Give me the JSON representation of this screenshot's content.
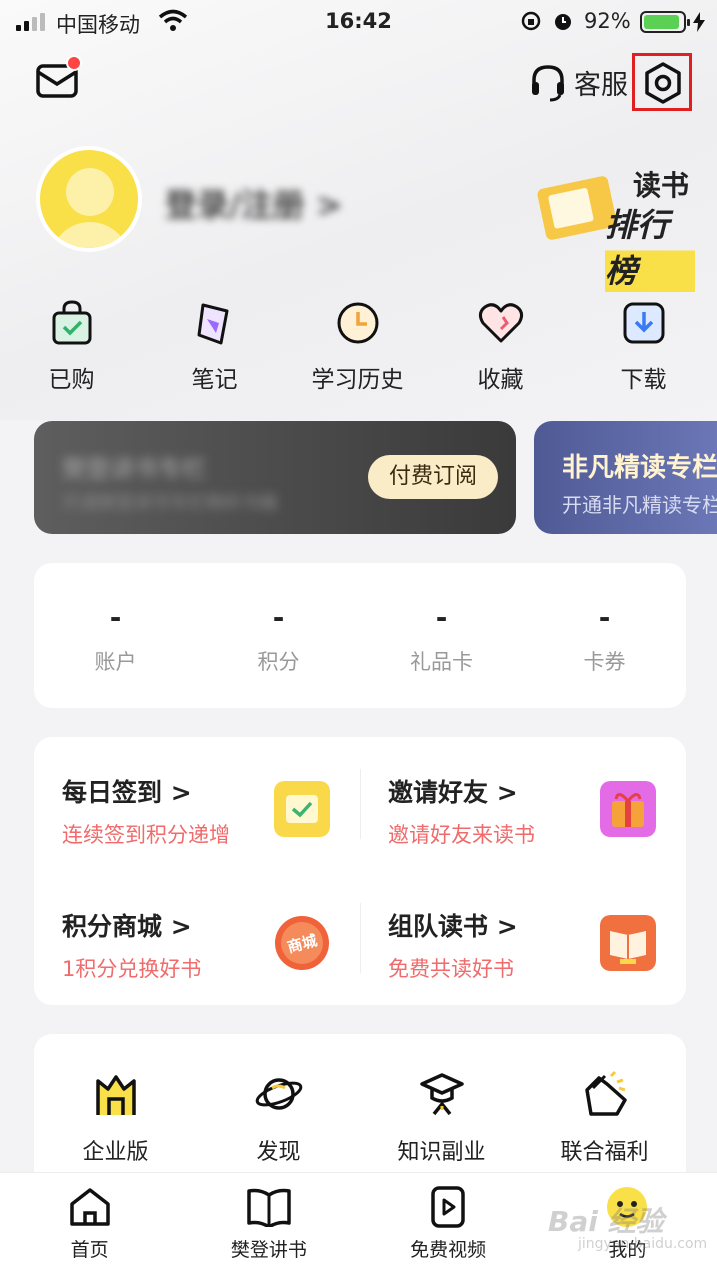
{
  "status_bar": {
    "carrier": "中国移动",
    "time": "16:42",
    "battery": "92%",
    "battery_level": 0.92
  },
  "header": {
    "service_label": "客服"
  },
  "profile": {
    "login_label": "登录/注册 >",
    "rank_line1": "读书",
    "rank_line2": "排行榜"
  },
  "quick_menu": [
    {
      "label": "已购",
      "icon": "shopping-bag-icon"
    },
    {
      "label": "笔记",
      "icon": "note-icon"
    },
    {
      "label": "学习历史",
      "icon": "clock-icon"
    },
    {
      "label": "收藏",
      "icon": "heart-icon"
    },
    {
      "label": "下载",
      "icon": "download-icon"
    }
  ],
  "vip_cards": {
    "first": {
      "title": "樊登讲书专栏",
      "subtitle": "开通樊登讲书专栏畅听书籍",
      "button": "付费订阅"
    },
    "second": {
      "title": "非凡精读专栏",
      "subtitle": "开通非凡精读专栏"
    }
  },
  "assets": [
    {
      "value": "-",
      "label": "账户"
    },
    {
      "value": "-",
      "label": "积分"
    },
    {
      "value": "-",
      "label": "礼品卡"
    },
    {
      "value": "-",
      "label": "卡券"
    }
  ],
  "tasks": [
    {
      "title": "每日签到 >",
      "subtitle": "连续签到积分递增",
      "icon": "calendar-check-icon",
      "color": "#f9d84a"
    },
    {
      "title": "邀请好友 >",
      "subtitle": "邀请好友来读书",
      "icon": "gift-icon",
      "color": "#e46be6"
    },
    {
      "title": "积分商城 >",
      "subtitle": "1积分兑换好书",
      "icon": "mall-badge-icon",
      "color": "#f0623a",
      "badge_text": "商城"
    },
    {
      "title": "组队读书 >",
      "subtitle": "免费共读好书",
      "icon": "open-book-icon",
      "color": "#f07040"
    }
  ],
  "tools": [
    {
      "label": "企业版",
      "icon": "enterprise-icon"
    },
    {
      "label": "发现",
      "icon": "planet-icon"
    },
    {
      "label": "知识副业",
      "icon": "graduation-cap-icon"
    },
    {
      "label": "联合福利",
      "icon": "coupon-icon"
    }
  ],
  "tabbar": [
    {
      "label": "首页",
      "icon": "home-icon"
    },
    {
      "label": "樊登讲书",
      "icon": "book-icon"
    },
    {
      "label": "免费视频",
      "icon": "video-icon"
    },
    {
      "label": "我的",
      "icon": "my-face-icon"
    }
  ],
  "watermark": {
    "main": "Bai 经验",
    "sub": "jingyan.baidu.com"
  },
  "colors": {
    "accent_yellow": "#f9df48",
    "task_red": "#f06b6b",
    "highlight_box": "#e02020"
  }
}
